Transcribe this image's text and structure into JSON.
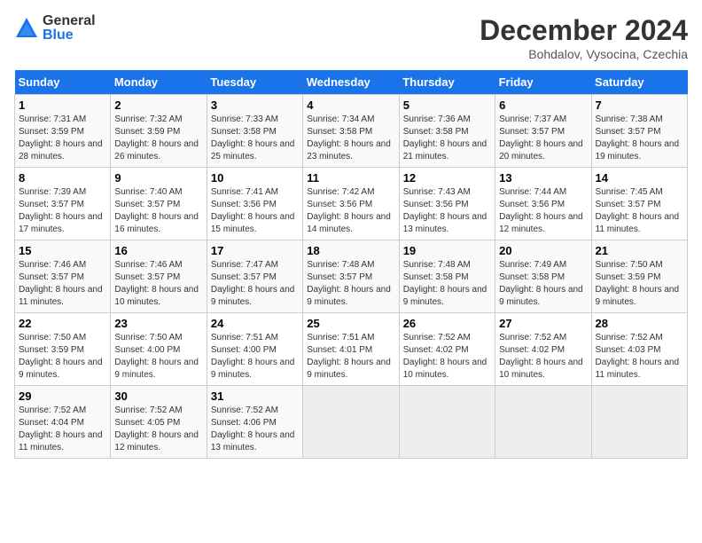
{
  "header": {
    "logo_general": "General",
    "logo_blue": "Blue",
    "month_title": "December 2024",
    "subtitle": "Bohdalov, Vysocina, Czechia"
  },
  "days_of_week": [
    "Sunday",
    "Monday",
    "Tuesday",
    "Wednesday",
    "Thursday",
    "Friday",
    "Saturday"
  ],
  "weeks": [
    [
      {
        "day": "1",
        "sunrise": "Sunrise: 7:31 AM",
        "sunset": "Sunset: 3:59 PM",
        "daylight": "Daylight: 8 hours and 28 minutes."
      },
      {
        "day": "2",
        "sunrise": "Sunrise: 7:32 AM",
        "sunset": "Sunset: 3:59 PM",
        "daylight": "Daylight: 8 hours and 26 minutes."
      },
      {
        "day": "3",
        "sunrise": "Sunrise: 7:33 AM",
        "sunset": "Sunset: 3:58 PM",
        "daylight": "Daylight: 8 hours and 25 minutes."
      },
      {
        "day": "4",
        "sunrise": "Sunrise: 7:34 AM",
        "sunset": "Sunset: 3:58 PM",
        "daylight": "Daylight: 8 hours and 23 minutes."
      },
      {
        "day": "5",
        "sunrise": "Sunrise: 7:36 AM",
        "sunset": "Sunset: 3:58 PM",
        "daylight": "Daylight: 8 hours and 21 minutes."
      },
      {
        "day": "6",
        "sunrise": "Sunrise: 7:37 AM",
        "sunset": "Sunset: 3:57 PM",
        "daylight": "Daylight: 8 hours and 20 minutes."
      },
      {
        "day": "7",
        "sunrise": "Sunrise: 7:38 AM",
        "sunset": "Sunset: 3:57 PM",
        "daylight": "Daylight: 8 hours and 19 minutes."
      }
    ],
    [
      {
        "day": "8",
        "sunrise": "Sunrise: 7:39 AM",
        "sunset": "Sunset: 3:57 PM",
        "daylight": "Daylight: 8 hours and 17 minutes."
      },
      {
        "day": "9",
        "sunrise": "Sunrise: 7:40 AM",
        "sunset": "Sunset: 3:57 PM",
        "daylight": "Daylight: 8 hours and 16 minutes."
      },
      {
        "day": "10",
        "sunrise": "Sunrise: 7:41 AM",
        "sunset": "Sunset: 3:56 PM",
        "daylight": "Daylight: 8 hours and 15 minutes."
      },
      {
        "day": "11",
        "sunrise": "Sunrise: 7:42 AM",
        "sunset": "Sunset: 3:56 PM",
        "daylight": "Daylight: 8 hours and 14 minutes."
      },
      {
        "day": "12",
        "sunrise": "Sunrise: 7:43 AM",
        "sunset": "Sunset: 3:56 PM",
        "daylight": "Daylight: 8 hours and 13 minutes."
      },
      {
        "day": "13",
        "sunrise": "Sunrise: 7:44 AM",
        "sunset": "Sunset: 3:56 PM",
        "daylight": "Daylight: 8 hours and 12 minutes."
      },
      {
        "day": "14",
        "sunrise": "Sunrise: 7:45 AM",
        "sunset": "Sunset: 3:57 PM",
        "daylight": "Daylight: 8 hours and 11 minutes."
      }
    ],
    [
      {
        "day": "15",
        "sunrise": "Sunrise: 7:46 AM",
        "sunset": "Sunset: 3:57 PM",
        "daylight": "Daylight: 8 hours and 11 minutes."
      },
      {
        "day": "16",
        "sunrise": "Sunrise: 7:46 AM",
        "sunset": "Sunset: 3:57 PM",
        "daylight": "Daylight: 8 hours and 10 minutes."
      },
      {
        "day": "17",
        "sunrise": "Sunrise: 7:47 AM",
        "sunset": "Sunset: 3:57 PM",
        "daylight": "Daylight: 8 hours and 9 minutes."
      },
      {
        "day": "18",
        "sunrise": "Sunrise: 7:48 AM",
        "sunset": "Sunset: 3:57 PM",
        "daylight": "Daylight: 8 hours and 9 minutes."
      },
      {
        "day": "19",
        "sunrise": "Sunrise: 7:48 AM",
        "sunset": "Sunset: 3:58 PM",
        "daylight": "Daylight: 8 hours and 9 minutes."
      },
      {
        "day": "20",
        "sunrise": "Sunrise: 7:49 AM",
        "sunset": "Sunset: 3:58 PM",
        "daylight": "Daylight: 8 hours and 9 minutes."
      },
      {
        "day": "21",
        "sunrise": "Sunrise: 7:50 AM",
        "sunset": "Sunset: 3:59 PM",
        "daylight": "Daylight: 8 hours and 9 minutes."
      }
    ],
    [
      {
        "day": "22",
        "sunrise": "Sunrise: 7:50 AM",
        "sunset": "Sunset: 3:59 PM",
        "daylight": "Daylight: 8 hours and 9 minutes."
      },
      {
        "day": "23",
        "sunrise": "Sunrise: 7:50 AM",
        "sunset": "Sunset: 4:00 PM",
        "daylight": "Daylight: 8 hours and 9 minutes."
      },
      {
        "day": "24",
        "sunrise": "Sunrise: 7:51 AM",
        "sunset": "Sunset: 4:00 PM",
        "daylight": "Daylight: 8 hours and 9 minutes."
      },
      {
        "day": "25",
        "sunrise": "Sunrise: 7:51 AM",
        "sunset": "Sunset: 4:01 PM",
        "daylight": "Daylight: 8 hours and 9 minutes."
      },
      {
        "day": "26",
        "sunrise": "Sunrise: 7:52 AM",
        "sunset": "Sunset: 4:02 PM",
        "daylight": "Daylight: 8 hours and 10 minutes."
      },
      {
        "day": "27",
        "sunrise": "Sunrise: 7:52 AM",
        "sunset": "Sunset: 4:02 PM",
        "daylight": "Daylight: 8 hours and 10 minutes."
      },
      {
        "day": "28",
        "sunrise": "Sunrise: 7:52 AM",
        "sunset": "Sunset: 4:03 PM",
        "daylight": "Daylight: 8 hours and 11 minutes."
      }
    ],
    [
      {
        "day": "29",
        "sunrise": "Sunrise: 7:52 AM",
        "sunset": "Sunset: 4:04 PM",
        "daylight": "Daylight: 8 hours and 11 minutes."
      },
      {
        "day": "30",
        "sunrise": "Sunrise: 7:52 AM",
        "sunset": "Sunset: 4:05 PM",
        "daylight": "Daylight: 8 hours and 12 minutes."
      },
      {
        "day": "31",
        "sunrise": "Sunrise: 7:52 AM",
        "sunset": "Sunset: 4:06 PM",
        "daylight": "Daylight: 8 hours and 13 minutes."
      },
      null,
      null,
      null,
      null
    ]
  ]
}
